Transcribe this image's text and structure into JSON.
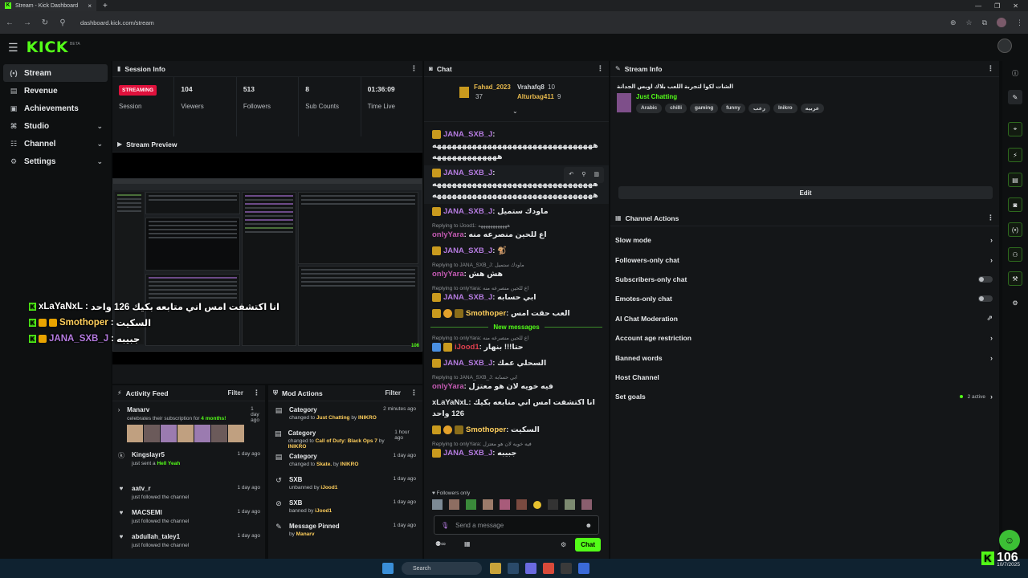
{
  "browser": {
    "tab_title": "Stream - Kick Dashboard",
    "url": "dashboard.kick.com/stream"
  },
  "app": {
    "logo": "KICK",
    "beta": "BETA"
  },
  "sidebar": {
    "items": [
      {
        "label": "Stream",
        "icon": "stream-icon"
      },
      {
        "label": "Revenue",
        "icon": "revenue-icon"
      },
      {
        "label": "Achievements",
        "icon": "achievements-icon"
      },
      {
        "label": "Studio",
        "icon": "studio-icon"
      },
      {
        "label": "Channel",
        "icon": "channel-icon"
      },
      {
        "label": "Settings",
        "icon": "settings-icon"
      }
    ]
  },
  "session": {
    "title": "Session Info",
    "badge": "STREAMING",
    "stats": [
      {
        "value": "",
        "label": "Session"
      },
      {
        "value": "104",
        "label": "Viewers"
      },
      {
        "value": "513",
        "label": "Followers"
      },
      {
        "value": "8",
        "label": "Sub Counts"
      },
      {
        "value": "01:36:09",
        "label": "Time Live"
      }
    ]
  },
  "preview": {
    "title": "Stream Preview",
    "overlay": [
      {
        "user": "xLaYaNxL",
        "text": "انا اكتشفت امس اني متابعه بكيك 126 واحد"
      },
      {
        "user": "Smothoper",
        "text": "السكيت"
      },
      {
        "user": "JANA_SXB_J",
        "text": "جبيبه"
      }
    ]
  },
  "activity": {
    "title": "Activity Feed",
    "filter": "Filter",
    "items": [
      {
        "name": "Manarv",
        "sub_pre": "celebrates their subscription for ",
        "sub_hl": "4 months!",
        "time": "1 day ago"
      },
      {
        "name": "Kingslayr5",
        "sub_pre": "just sent a ",
        "sub_hl": "Hell Yeah",
        "time": "1 day ago"
      },
      {
        "name": "aatv_r",
        "sub_pre": "just followed the channel",
        "sub_hl": "",
        "time": "1 day ago"
      },
      {
        "name": "MACSEMI",
        "sub_pre": "just followed the channel",
        "sub_hl": "",
        "time": "1 day ago"
      },
      {
        "name": "abdullah_taley1",
        "sub_pre": "just followed the channel",
        "sub_hl": "",
        "time": "1 day ago"
      }
    ]
  },
  "mod": {
    "title": "Mod Actions",
    "filter": "Filter",
    "items": [
      {
        "name": "Category",
        "pre": "changed to ",
        "hl": "Just Chatting",
        "mid": " by ",
        "by": "INIKRO",
        "time": "2 minutes ago"
      },
      {
        "name": "Category",
        "pre": "changed to ",
        "hl": "Call of Duty: Black Ops 7",
        "mid": " by ",
        "by": "INIKRO",
        "time": "1 hour ago"
      },
      {
        "name": "Category",
        "pre": "changed to ",
        "hl": "Skate.",
        "mid": " by ",
        "by": "INIKRO",
        "time": "1 day ago"
      },
      {
        "name": "SXB",
        "pre": "unbanned by ",
        "hl": "",
        "mid": "",
        "by": "iJood1",
        "time": "1 day ago"
      },
      {
        "name": "SXB",
        "pre": "banned by ",
        "hl": "",
        "mid": "",
        "by": "iJood1",
        "time": "1 day ago"
      },
      {
        "name": "Message Pinned",
        "pre": "by ",
        "hl": "",
        "mid": "",
        "by": "Manarv",
        "time": "1 day ago"
      }
    ]
  },
  "chat": {
    "title": "Chat",
    "gifters": [
      {
        "name": "Fahad_2023",
        "count": "37"
      },
      {
        "name": "Vrahafq8",
        "count": "10"
      },
      {
        "name": "Alturbag411",
        "count": "9"
      }
    ],
    "long_msg_1": "ههههههههههههههههههههههههههههههههه",
    "long_msg_2": "هههههههههههههه",
    "messages": [
      {
        "reply": "",
        "user": "JANA_SXB_J",
        "color": "#b57be0",
        "text": "ماودك ستميل"
      },
      {
        "reply": "Replying to iJood1: ههههههههههههه",
        "user": "onlyYara",
        "color": "#c45ab3",
        "text": "اع للحين منصرعه منه"
      },
      {
        "reply": "",
        "user": "JANA_SXB_J",
        "color": "#b57be0",
        "text": ""
      },
      {
        "reply": "Replying to JANA_SXB_J: ماودك ستميل",
        "user": "onlyYara",
        "color": "#c45ab3",
        "text": "هش هش"
      },
      {
        "reply": "Replying to onlyYara: اع للحين منصرعه منه",
        "user": "JANA_SXB_J",
        "color": "#b57be0",
        "text": "ابي حسابه"
      },
      {
        "reply": "",
        "user": "Smothoper",
        "color": "#ffcf5c",
        "text": "العب حقت امس"
      }
    ],
    "new_messages": "New messages",
    "messages2": [
      {
        "reply": "Replying to onlyYara: اع للحين منصرعه منه",
        "user": "iJood1",
        "color": "#e0404f",
        "text": "حتا!!! بنهار"
      },
      {
        "reply": "",
        "user": "JANA_SXB_J",
        "color": "#b57be0",
        "text": "السحلي عمك"
      },
      {
        "reply": "Replying to JANA_SXB_J: ابي حسابه",
        "user": "onlyYara",
        "color": "#c45ab3",
        "text": "فيه خويه لان هو معتزل"
      },
      {
        "reply": "",
        "user": "xLaYaNxL",
        "color": "#e6e8ea",
        "text": "انا اكتشفت امس اني متابعه بكيك 126 واحد"
      },
      {
        "reply": "",
        "user": "Smothoper",
        "color": "#ffcf5c",
        "text": "السكيت"
      },
      {
        "reply": "Replying to onlyYara: فيه خويه لان هو معتزل",
        "user": "JANA_SXB_J",
        "color": "#b57be0",
        "text": "جبيبه"
      }
    ],
    "followers_only": "Followers only",
    "placeholder": "Send a message",
    "send": "Chat"
  },
  "stream_info": {
    "title": "Stream Info",
    "stream_title": "الشات لكوا لتجربة اللعب بلاك اوبس الجدانة",
    "category": "Just Chatting",
    "tags": [
      "Arabic",
      "chilli",
      "gaming",
      "funny",
      "رعب",
      "Inikro",
      "عربيه"
    ],
    "edit": "Edit"
  },
  "channel_actions": {
    "title": "Channel Actions",
    "items": [
      {
        "label": "Slow mode",
        "control": "chevron"
      },
      {
        "label": "Followers-only chat",
        "control": "chevron"
      },
      {
        "label": "Subscribers-only chat",
        "control": "toggle"
      },
      {
        "label": "Emotes-only chat",
        "control": "toggle"
      },
      {
        "label": "AI Chat Moderation",
        "control": "external"
      },
      {
        "label": "Account age restriction",
        "control": "chevron"
      },
      {
        "label": "Banned words",
        "control": "chevron"
      },
      {
        "label": "Host Channel",
        "control": "none"
      },
      {
        "label": "Set goals",
        "control": "chevron",
        "extra": "2 active"
      }
    ]
  },
  "taskbar": {
    "search": "Search",
    "date": "10/7/2025"
  },
  "kick_overlay_count": "106"
}
